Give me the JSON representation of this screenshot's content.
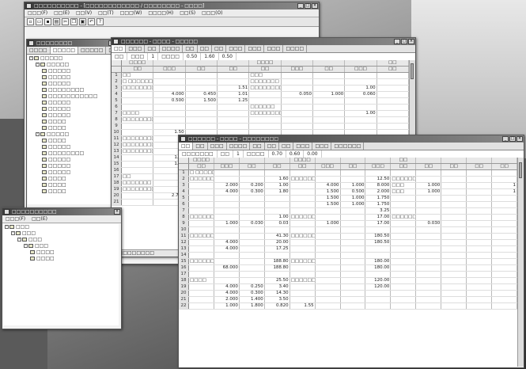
{
  "app": {
    "title": "□□□□□□□□□□ - [□□□□□□□□□□□□ / □□□□□□□□ - □□□□]",
    "menu": [
      "□□□(F)",
      "□□(E)",
      "□□(V)",
      "□□(T)",
      "□□□(W)",
      "□□□□(H)",
      "□□(S)",
      "□□□(O)"
    ],
    "toolbar_icons": [
      "new-icon",
      "open-icon",
      "save-icon",
      "print-icon",
      "cut-icon",
      "copy-icon",
      "paste-icon",
      "undo-icon",
      "help-icon"
    ]
  },
  "tree_panel": {
    "title": "□□□□□□□□",
    "tabs": [
      "□□□□",
      "□□□□□",
      "□□□□□",
      "□□□□"
    ],
    "nodes": [
      {
        "label": "□□□□□",
        "level": 0,
        "expander": "-"
      },
      {
        "label": "□□□□□",
        "level": 1,
        "expander": "-"
      },
      {
        "label": "□□□□□",
        "level": 2
      },
      {
        "label": "□□□□□",
        "level": 2
      },
      {
        "label": "□□□□□",
        "level": 2
      },
      {
        "label": "□□□□□□□□",
        "level": 2
      },
      {
        "label": "□□□□□□□□□□□",
        "level": 2
      },
      {
        "label": "□□□□□",
        "level": 2
      },
      {
        "label": "□□□□□",
        "level": 2
      },
      {
        "label": "□□□□□",
        "level": 2
      },
      {
        "label": "□□□□",
        "level": 2
      },
      {
        "label": "□□□□",
        "level": 2
      },
      {
        "label": "□□□□□",
        "level": 1,
        "expander": "-"
      },
      {
        "label": "□□□□",
        "level": 2
      },
      {
        "label": "□□□□□",
        "level": 2
      },
      {
        "label": "□□□□□□□□",
        "level": 2
      },
      {
        "label": "□□□□□",
        "level": 2
      },
      {
        "label": "□□□□□",
        "level": 2
      },
      {
        "label": "□□□□□",
        "level": 2
      },
      {
        "label": "□□□□",
        "level": 2
      },
      {
        "label": "□□□□",
        "level": 2
      },
      {
        "label": "□□□□",
        "level": 2
      }
    ]
  },
  "bottom_panel": {
    "title": "□□□□□□□□□□",
    "menu": [
      "□□□(F)",
      "□□(E)"
    ],
    "nodes": [
      {
        "label": "□□□",
        "level": 0,
        "expander": "-"
      },
      {
        "label": "□□□",
        "level": 1,
        "expander": "-"
      },
      {
        "label": "□□□",
        "level": 2,
        "expander": "-"
      },
      {
        "label": "□□□",
        "level": 3,
        "expander": "-"
      },
      {
        "label": "□□□□",
        "level": 4
      },
      {
        "label": "□□□□",
        "level": 4
      }
    ]
  },
  "window1": {
    "title": "□□□□□□ - □□□□ - □□□□□",
    "tabs": [
      "□□",
      "□□□",
      "□□",
      "□□□□",
      "□□",
      "□□",
      "□□",
      "□□□",
      "□□□",
      "□□□",
      "□□□□"
    ],
    "formula": [
      "□□",
      "□□□",
      "1",
      "□□□□",
      "0.50",
      "1.60",
      "0.50"
    ],
    "header_row1": [
      "",
      "□□□□",
      "",
      "",
      "",
      "□□□□",
      "",
      "",
      "",
      "□□"
    ],
    "header_row2": [
      "",
      "□□",
      "□□□",
      "□□",
      "□□",
      "□□",
      "□□□",
      "□□",
      "□□□",
      "□□"
    ],
    "rows": [
      [
        "1",
        "□□",
        "",
        "",
        "",
        "□□□",
        "",
        "",
        "",
        ""
      ],
      [
        "2",
        "□ □□□□□□□□□□□",
        "",
        "",
        "",
        "□□□□□□□",
        "",
        "",
        "",
        ""
      ],
      [
        "3",
        "□□□□□□□□□□□",
        "",
        "",
        "1.51",
        "□□□□□□□□□□□□",
        "",
        "",
        "1.00",
        ""
      ],
      [
        "4",
        "",
        "4.000",
        "0.450",
        "1.01",
        "",
        "0.050",
        "1.000",
        "0.060",
        ""
      ],
      [
        "5",
        "",
        "0.500",
        "1.500",
        "1.25",
        "",
        "",
        "",
        "",
        ""
      ],
      [
        "6",
        "",
        "",
        "",
        "",
        "□□□□□□",
        "",
        "",
        "",
        ""
      ],
      [
        "7",
        "□□□□",
        "",
        "",
        "",
        "□□□□□□□□□□□",
        "",
        "",
        "1.00",
        ""
      ],
      [
        "8",
        "□□□□□□□□",
        "",
        "",
        "",
        "",
        "",
        "",
        "",
        ""
      ],
      [
        "9",
        "",
        "",
        "",
        "",
        "",
        "",
        "",
        "",
        ""
      ],
      [
        "10",
        "",
        "1.50",
        "",
        "",
        "",
        "",
        "",
        "",
        ""
      ],
      [
        "11",
        "□□□□□□□□□",
        "",
        "",
        "",
        "",
        "",
        "",
        "",
        ""
      ],
      [
        "12",
        "□□□□□□□□",
        "",
        "",
        "",
        "",
        "",
        "",
        "",
        ""
      ],
      [
        "13",
        "□□□□□□□□□□□□□",
        "",
        "",
        "",
        "",
        "",
        "",
        "",
        ""
      ],
      [
        "14",
        "",
        "1.75",
        "",
        "",
        "",
        "",
        "",
        "",
        ""
      ],
      [
        "15",
        "",
        "1.75",
        "",
        "",
        "",
        "",
        "",
        "",
        ""
      ],
      [
        "16",
        "",
        "",
        "",
        "",
        "",
        "",
        "",
        "",
        ""
      ],
      [
        "17",
        "□□",
        "",
        "",
        "",
        "",
        "",
        "",
        "",
        ""
      ],
      [
        "18",
        "□□□□□□□",
        "",
        "",
        "",
        "",
        "",
        "",
        "",
        ""
      ],
      [
        "19",
        "□□□□□□□□□□",
        "",
        "",
        "",
        "",
        "",
        "",
        "",
        ""
      ],
      [
        "20",
        "",
        "2.750",
        "1",
        "",
        "",
        "",
        "",
        "",
        ""
      ],
      [
        "21",
        "",
        "",
        "",
        "",
        "",
        "",
        "",
        "",
        ""
      ]
    ],
    "status": "□□□□□□□□□"
  },
  "window2": {
    "title": "□□□□□□ - □□□□ - □□□□□□□□",
    "tabs": [
      "□□",
      "□□",
      "□□□",
      "□□□□",
      "□□",
      "□□",
      "□□",
      "□□□",
      "□□□",
      "□□□□□□"
    ],
    "formula": [
      "□□□□□□□",
      "□□",
      "1",
      "□□□□",
      "0.70",
      "0.60",
      "0.00"
    ],
    "header_row1": [
      "",
      "□□□□",
      "",
      "",
      "",
      "□□□□",
      "",
      "",
      "",
      "□□",
      "",
      "",
      "",
      ""
    ],
    "header_row2": [
      "",
      "□□",
      "□□□",
      "□□",
      "□□",
      "□□",
      "□□□",
      "□□",
      "□□□",
      "□□",
      "□□",
      "□□",
      "□□",
      "□□"
    ],
    "rows": [
      [
        "1",
        "□ □□□□□□",
        "",
        "",
        "",
        "",
        "",
        "",
        "",
        "",
        "",
        "",
        "",
        ""
      ],
      [
        "2",
        "□□□□□□□□□□□",
        "",
        "",
        "1.60",
        "□□□□□□□□□□",
        "",
        "",
        "12.50",
        "□□□□□□",
        "",
        "",
        "",
        ""
      ],
      [
        "3",
        "",
        "2.000",
        "0.200",
        "1.00",
        "",
        "4.000",
        "1.000",
        "8.000",
        "□□□",
        "1.000",
        "",
        "",
        "1"
      ],
      [
        "4",
        "",
        "4.000",
        "0.300",
        "1.80",
        "",
        "1.500",
        "0.500",
        "2.000",
        "□□□",
        "1.000",
        "",
        "",
        "1"
      ],
      [
        "5",
        "",
        "",
        "",
        "",
        "",
        "1.500",
        "1.000",
        "1.750",
        "",
        "",
        "",
        "",
        ""
      ],
      [
        "6",
        "",
        "",
        "",
        "",
        "",
        "1.500",
        "1.000",
        "1.750",
        "",
        "",
        "",
        "",
        ""
      ],
      [
        "7",
        "",
        "",
        "",
        "",
        "",
        "",
        "",
        "3.25",
        "",
        "",
        "",
        "",
        ""
      ],
      [
        "8",
        "□□□□□□□□□□□□□□",
        "",
        "",
        "1.00",
        "□□□□□□□□□□□□□",
        "",
        "",
        "17.00",
        "□□□□□□",
        "",
        "",
        "",
        ""
      ],
      [
        "9",
        "",
        "1.000",
        "0.030",
        "0.03",
        "",
        "1.000",
        "",
        "17.00",
        "",
        "0.030",
        "",
        "",
        ""
      ],
      [
        "10",
        "",
        "",
        "",
        "",
        "",
        "",
        "",
        "",
        "",
        "",
        "",
        "",
        ""
      ],
      [
        "11",
        "□□□□□□□□□□□□",
        "",
        "",
        "41.30",
        "□□□□□□□□□□□",
        "",
        "",
        "180.50",
        "",
        "",
        "",
        "",
        ""
      ],
      [
        "12",
        "",
        "4.000",
        "",
        "20.00",
        "",
        "",
        "",
        "180.50",
        "",
        "",
        "",
        "",
        ""
      ],
      [
        "13",
        "",
        "4.000",
        "",
        "17.25",
        "",
        "",
        "",
        "",
        "",
        "",
        "",
        "",
        ""
      ],
      [
        "14",
        "",
        "",
        "",
        "",
        "",
        "",
        "",
        "",
        "",
        "",
        "",
        "",
        ""
      ],
      [
        "15",
        "□□□□□□□□□",
        "",
        "",
        "188.80",
        "□□□□□□□□□□□",
        "",
        "",
        "180.00",
        "",
        "",
        "",
        "",
        ""
      ],
      [
        "16",
        "",
        "68.000",
        "",
        "188.80",
        "",
        "",
        "",
        "180.00",
        "",
        "",
        "",
        "",
        ""
      ],
      [
        "17",
        "",
        "",
        "",
        "",
        "",
        "",
        "",
        "",
        "",
        "",
        "",
        "",
        ""
      ],
      [
        "18",
        "□□□□",
        "",
        "",
        "25.50",
        "□□□□□□□□□□□",
        "",
        "",
        "120.00",
        "",
        "",
        "",
        "",
        ""
      ],
      [
        "19",
        "",
        "4.000",
        "0.250",
        "3.40",
        "",
        "",
        "",
        "120.00",
        "",
        "",
        "",
        "",
        ""
      ],
      [
        "20",
        "",
        "4.000",
        "0.300",
        "14.30",
        "",
        "",
        "",
        "",
        "",
        "",
        "",
        "",
        ""
      ],
      [
        "21",
        "",
        "2.000",
        "1.400",
        "3.50",
        "",
        "",
        "",
        "",
        "",
        "",
        "",
        "",
        ""
      ],
      [
        "22",
        "",
        "1.000",
        "1.800",
        "0.820",
        "1.55",
        "",
        "",
        "",
        "",
        "",
        "",
        "",
        ""
      ]
    ]
  }
}
